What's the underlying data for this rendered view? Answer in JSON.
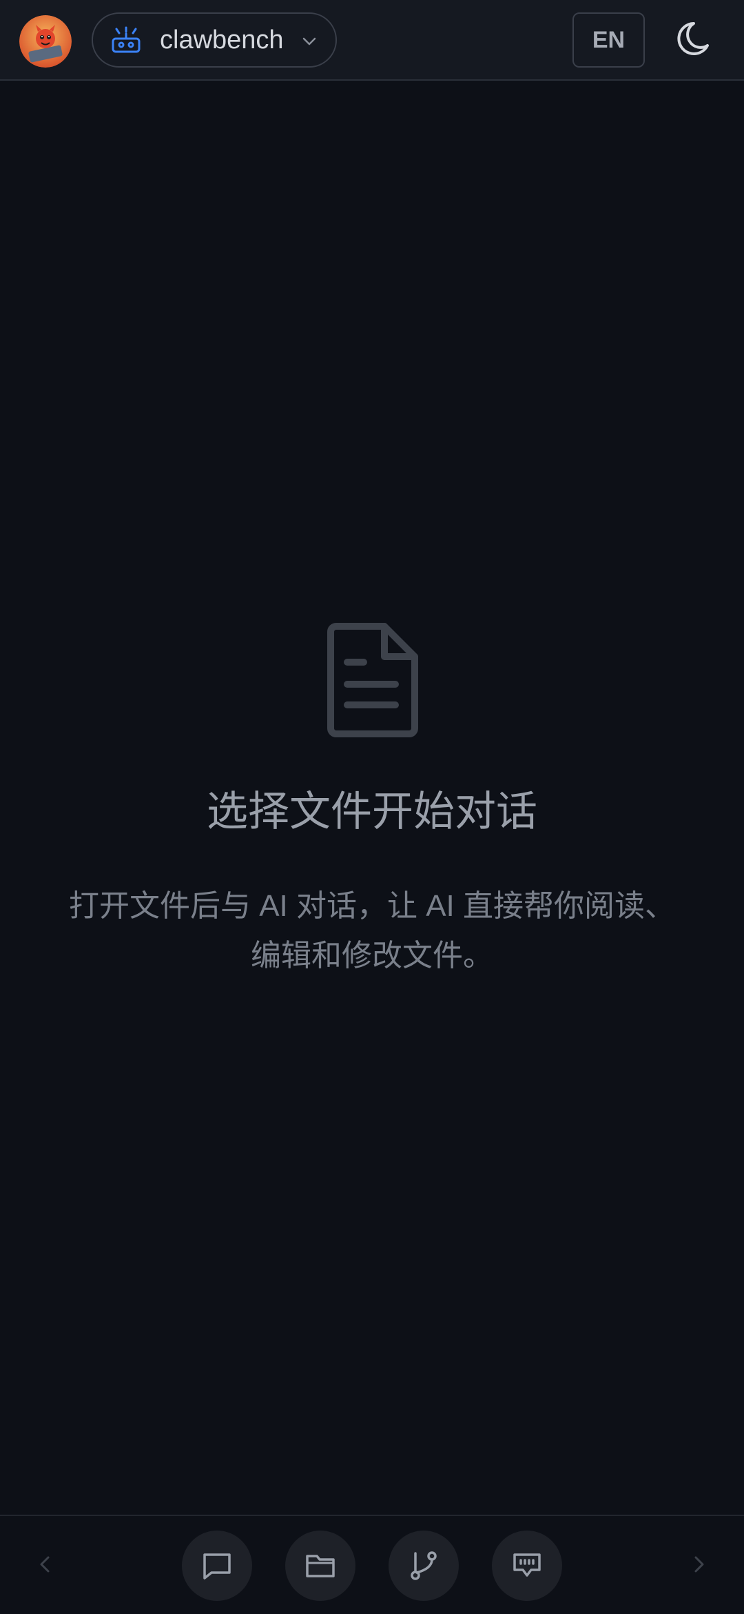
{
  "header": {
    "workspace_name": "clawbench",
    "language_label": "EN",
    "avatar_icon": "devil-mascot-avatar",
    "workspace_icon": "robot-icon",
    "theme_icon": "moon-icon"
  },
  "empty_state": {
    "icon": "document-icon",
    "title": "选择文件开始对话",
    "description": "打开文件后与 AI 对话，让 AI 直接帮你阅读、编辑和修改文件。"
  },
  "bottom_nav": {
    "items": [
      {
        "icon": "chat-icon"
      },
      {
        "icon": "folder-icon"
      },
      {
        "icon": "git-branch-icon"
      },
      {
        "icon": "terminal-icon"
      }
    ]
  },
  "colors": {
    "background": "#0d1017",
    "header_bg": "#151921",
    "accent_blue": "#3b82f6",
    "button_bg": "#1e2128"
  }
}
